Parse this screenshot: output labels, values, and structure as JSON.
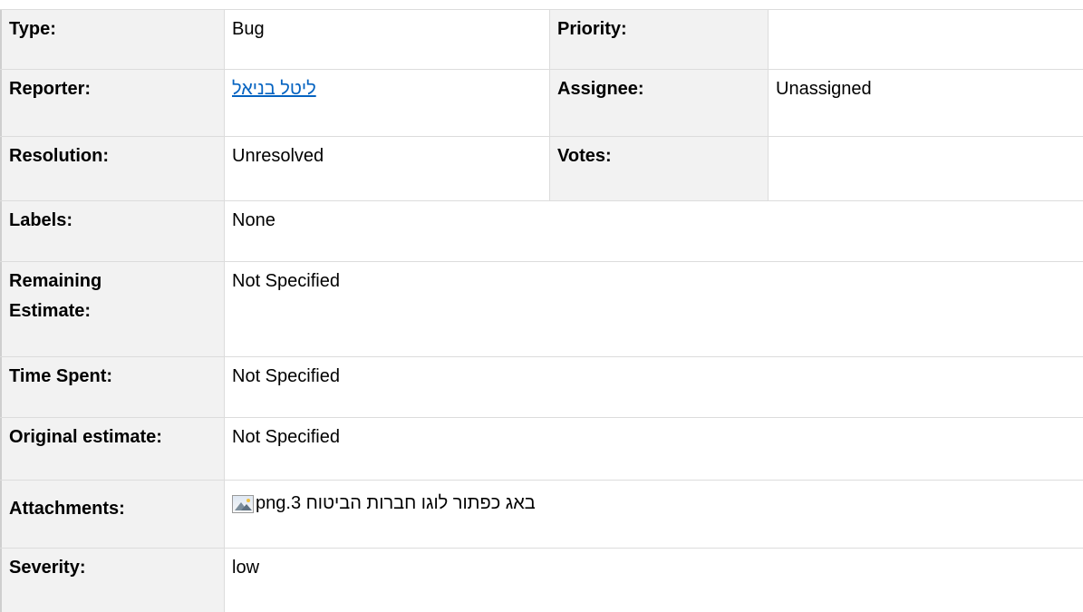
{
  "fields": {
    "type": {
      "label": "Type:",
      "value": "Bug"
    },
    "priority": {
      "label": "Priority:",
      "value": ""
    },
    "reporter": {
      "label": "Reporter:",
      "value": "ליטל בניאל"
    },
    "assignee": {
      "label": "Assignee:",
      "value": "Unassigned"
    },
    "resolution": {
      "label": "Resolution:",
      "value": "Unresolved"
    },
    "votes": {
      "label": "Votes:",
      "value": ""
    },
    "labels": {
      "label": "Labels:",
      "value": "None"
    },
    "remaining_estimate": {
      "label_line1": "Remaining",
      "label_line2": "Estimate:",
      "value": "Not Specified"
    },
    "time_spent": {
      "label": "Time Spent:",
      "value": "Not Specified"
    },
    "original_estimate": {
      "label": "Original estimate:",
      "value": "Not Specified"
    },
    "attachments": {
      "label": "Attachments:",
      "file_icon": "image-file-icon",
      "file_name": "png.באג כפתור לוגו חברות הביטוח 3"
    },
    "severity": {
      "label": "Severity:",
      "value": "low"
    }
  },
  "colors": {
    "label_bg": "#f2f2f2",
    "border": "#dcdcdc",
    "link": "#0563c1"
  }
}
